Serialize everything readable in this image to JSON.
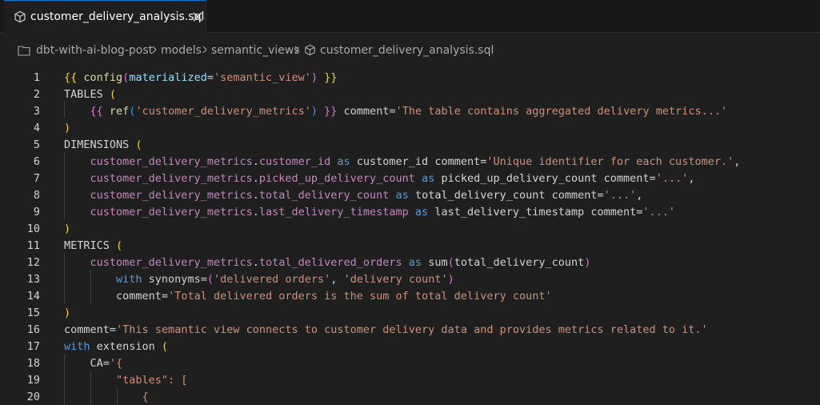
{
  "tab": {
    "label": "customer_delivery_analysis.sql",
    "icon": "cube-icon",
    "close_icon": "close-icon"
  },
  "breadcrumb": {
    "items": [
      "dbt-with-ai-blog-post",
      "models",
      "semantic_views",
      "customer_delivery_analysis.sql"
    ]
  },
  "colors": {
    "accent": "#0078d4",
    "keyword": "#569cd6",
    "string": "#ce9178",
    "column": "#c586c0",
    "bracket_yellow": "#ffd700",
    "bracket_purple": "#da70d6",
    "bracket_blue": "#179fff"
  },
  "editor": {
    "lines": [
      {
        "num": "1",
        "tokens": [
          [
            "br1",
            "{{ "
          ],
          [
            "fn",
            "config"
          ],
          [
            "br2",
            "("
          ],
          [
            "par",
            "materialized"
          ],
          [
            "def",
            "="
          ],
          [
            "str",
            "'semantic_view'"
          ],
          [
            "br2",
            ")"
          ],
          [
            "br1",
            " }}"
          ]
        ]
      },
      {
        "num": "2",
        "tokens": [
          [
            "tx",
            "TABLES "
          ],
          [
            "br1",
            "("
          ]
        ]
      },
      {
        "num": "3",
        "tokens": [
          [
            "tx",
            "    "
          ],
          [
            "br2",
            "{{ "
          ],
          [
            "fn",
            "ref"
          ],
          [
            "br3",
            "("
          ],
          [
            "str",
            "'customer_delivery_metrics'"
          ],
          [
            "br3",
            ")"
          ],
          [
            "br2",
            " }}"
          ],
          [
            "tx",
            " comment"
          ],
          [
            "def",
            "="
          ],
          [
            "str",
            "'The table contains aggregated delivery metrics...'"
          ]
        ]
      },
      {
        "num": "4",
        "tokens": [
          [
            "br1",
            ")"
          ]
        ]
      },
      {
        "num": "5",
        "tokens": [
          [
            "tx",
            "DIMENSIONS "
          ],
          [
            "br1",
            "("
          ]
        ]
      },
      {
        "num": "6",
        "tokens": [
          [
            "tx",
            "    "
          ],
          [
            "col",
            "customer_delivery_metrics"
          ],
          [
            "tx",
            "."
          ],
          [
            "col",
            "customer_id"
          ],
          [
            "kw",
            " as "
          ],
          [
            "tx",
            "customer_id comment"
          ],
          [
            "def",
            "="
          ],
          [
            "str",
            "'Unique identifier for each customer.'"
          ],
          [
            "tx",
            ","
          ]
        ]
      },
      {
        "num": "7",
        "tokens": [
          [
            "tx",
            "    "
          ],
          [
            "col",
            "customer_delivery_metrics"
          ],
          [
            "tx",
            "."
          ],
          [
            "col",
            "picked_up_delivery_count"
          ],
          [
            "kw",
            " as "
          ],
          [
            "tx",
            "picked_up_delivery_count comment"
          ],
          [
            "def",
            "="
          ],
          [
            "str",
            "'...'"
          ],
          [
            "tx",
            ","
          ]
        ]
      },
      {
        "num": "8",
        "tokens": [
          [
            "tx",
            "    "
          ],
          [
            "col",
            "customer_delivery_metrics"
          ],
          [
            "tx",
            "."
          ],
          [
            "col",
            "total_delivery_count"
          ],
          [
            "kw",
            " as "
          ],
          [
            "tx",
            "total_delivery_count comment"
          ],
          [
            "def",
            "="
          ],
          [
            "str",
            "'...'"
          ],
          [
            "tx",
            ","
          ]
        ]
      },
      {
        "num": "9",
        "tokens": [
          [
            "tx",
            "    "
          ],
          [
            "col",
            "customer_delivery_metrics"
          ],
          [
            "tx",
            "."
          ],
          [
            "col",
            "last_delivery_timestamp"
          ],
          [
            "kw",
            " as "
          ],
          [
            "tx",
            "last_delivery_timestamp comment"
          ],
          [
            "def",
            "="
          ],
          [
            "str",
            "'...'"
          ]
        ]
      },
      {
        "num": "10",
        "tokens": [
          [
            "br1",
            ")"
          ]
        ]
      },
      {
        "num": "11",
        "tokens": [
          [
            "tx",
            "METRICS "
          ],
          [
            "br1",
            "("
          ]
        ]
      },
      {
        "num": "12",
        "tokens": [
          [
            "tx",
            "    "
          ],
          [
            "col",
            "customer_delivery_metrics"
          ],
          [
            "tx",
            "."
          ],
          [
            "col",
            "total_delivered_orders"
          ],
          [
            "kw",
            " as "
          ],
          [
            "tx",
            "sum"
          ],
          [
            "br2",
            "("
          ],
          [
            "tx",
            "total_delivery_count"
          ],
          [
            "br2",
            ")"
          ]
        ]
      },
      {
        "num": "13",
        "tokens": [
          [
            "tx",
            "        "
          ],
          [
            "kw",
            "with "
          ],
          [
            "tx",
            "synonyms"
          ],
          [
            "def",
            "="
          ],
          [
            "br2",
            "("
          ],
          [
            "str",
            "'delivered orders'"
          ],
          [
            "tx",
            ", "
          ],
          [
            "str",
            "'delivery count'"
          ],
          [
            "br2",
            ")"
          ]
        ]
      },
      {
        "num": "14",
        "tokens": [
          [
            "tx",
            "        comment"
          ],
          [
            "def",
            "="
          ],
          [
            "str",
            "'Total delivered orders is the sum of total delivery count'"
          ]
        ]
      },
      {
        "num": "15",
        "tokens": [
          [
            "br1",
            ")"
          ]
        ]
      },
      {
        "num": "16",
        "tokens": [
          [
            "tx",
            "comment"
          ],
          [
            "def",
            "="
          ],
          [
            "str",
            "'This semantic view connects to customer delivery data and provides metrics related to it.'"
          ]
        ]
      },
      {
        "num": "17",
        "tokens": [
          [
            "kw",
            "with "
          ],
          [
            "tx",
            "extension "
          ],
          [
            "br1",
            "("
          ]
        ]
      },
      {
        "num": "18",
        "tokens": [
          [
            "tx",
            "    CA"
          ],
          [
            "def",
            "="
          ],
          [
            "str",
            "'{"
          ]
        ]
      },
      {
        "num": "19",
        "tokens": [
          [
            "tx",
            "        "
          ],
          [
            "str",
            "\"tables\": ["
          ]
        ]
      },
      {
        "num": "20",
        "tokens": [
          [
            "tx",
            "            "
          ],
          [
            "str",
            "{"
          ]
        ]
      }
    ]
  }
}
